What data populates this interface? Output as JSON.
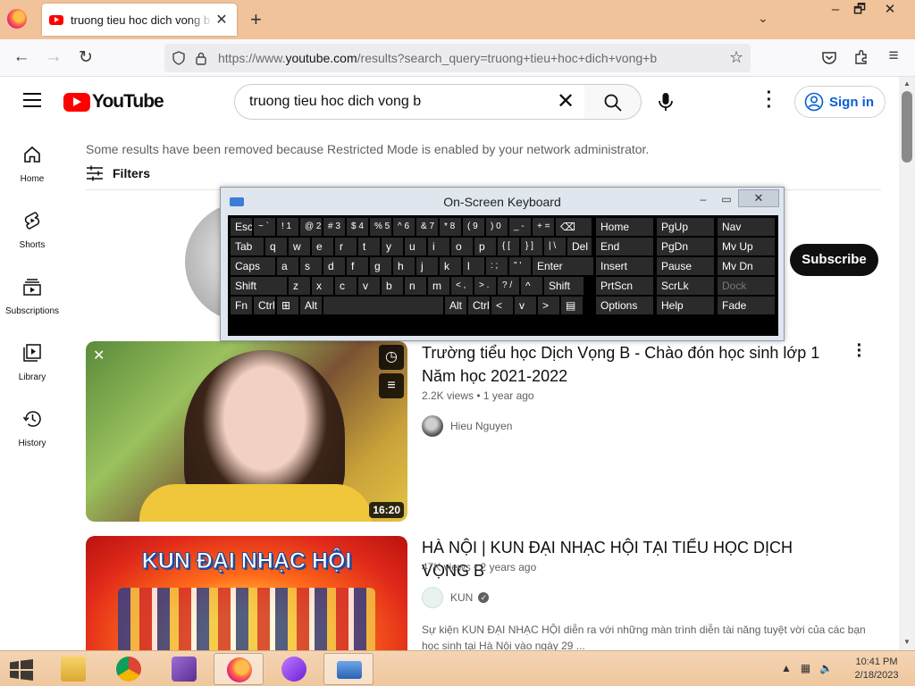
{
  "browser": {
    "tab_title": "truong tieu hoc dich vong b - YouTube",
    "url_prefix": "https://www.",
    "url_domain": "youtube.com",
    "url_path": "/results?search_query=truong+tieu+hoc+dich+vong+b",
    "window_controls": [
      "–",
      "🗗",
      "✕"
    ]
  },
  "youtube": {
    "logo_text": "YouTube",
    "search_value": "truong tieu hoc dich vong b",
    "signin_label": "Sign in",
    "guide": [
      {
        "label": "Home"
      },
      {
        "label": "Shorts"
      },
      {
        "label": "Subscriptions"
      },
      {
        "label": "Library"
      },
      {
        "label": "History"
      }
    ],
    "notice": "Some results have been removed because Restricted Mode is enabled by your network administrator.",
    "filters_label": "Filters",
    "subscribe_label": "Subscribe",
    "videos": [
      {
        "title": "Trường tiểu học Dịch Vọng B - Chào đón học sinh lớp 1 Năm học 2021-2022",
        "meta": "2.2K views • 1 year ago",
        "channel": "Hieu Nguyen",
        "duration": "16:20"
      },
      {
        "title": "HÀ NỘI | KUN ĐẠI NHẠC HỘI TẠI TIỂU HỌC DỊCH VỌNG B",
        "meta": "47K views • 2 years ago",
        "channel": "KUN",
        "thumb_text": "KUN ĐẠI NHẠC HỘI",
        "description": "Sự kiện KUN ĐẠI NHẠC HỘI diễn ra với những màn trình diễn tài năng tuyệt vời của các bạn học sinh tại Hà Nội vào ngày 29 ..."
      }
    ]
  },
  "osk": {
    "title": "On-Screen Keyboard",
    "row1": [
      "Esc",
      "~ `",
      "! 1",
      "@ 2",
      "# 3",
      "$ 4",
      "% 5",
      "^ 6",
      "& 7",
      "* 8",
      "( 9",
      ") 0",
      "_ -",
      "+ =",
      "⌫"
    ],
    "row2": [
      "Tab",
      "q",
      "w",
      "e",
      "r",
      "t",
      "y",
      "u",
      "i",
      "o",
      "p",
      "{ [",
      "} ]",
      "| \\",
      "Del"
    ],
    "row3": [
      "Caps",
      "a",
      "s",
      "d",
      "f",
      "g",
      "h",
      "j",
      "k",
      "l",
      ": ;",
      "\" '",
      "Enter"
    ],
    "row4": [
      "Shift",
      "z",
      "x",
      "c",
      "v",
      "b",
      "n",
      "m",
      "< ,",
      "> .",
      "? /",
      "^",
      "Shift"
    ],
    "row5": [
      "Fn",
      "Ctrl",
      "⊞",
      "Alt",
      "",
      "Alt",
      "Ctrl",
      "<",
      "v",
      ">",
      "▤"
    ],
    "nav": [
      [
        "Home",
        "PgUp",
        "Nav"
      ],
      [
        "End",
        "PgDn",
        "Mv Up"
      ],
      [
        "Insert",
        "Pause",
        "Mv Dn"
      ],
      [
        "PrtScn",
        "ScrLk",
        "Dock"
      ],
      [
        "Options",
        "Help",
        "Fade"
      ]
    ]
  },
  "taskbar": {
    "time": "10:41 PM",
    "date": "2/18/2023",
    "apps": [
      "file-explorer",
      "chrome",
      "visual-studio",
      "firefox",
      "visual-studio-preview",
      "on-screen-keyboard"
    ]
  }
}
